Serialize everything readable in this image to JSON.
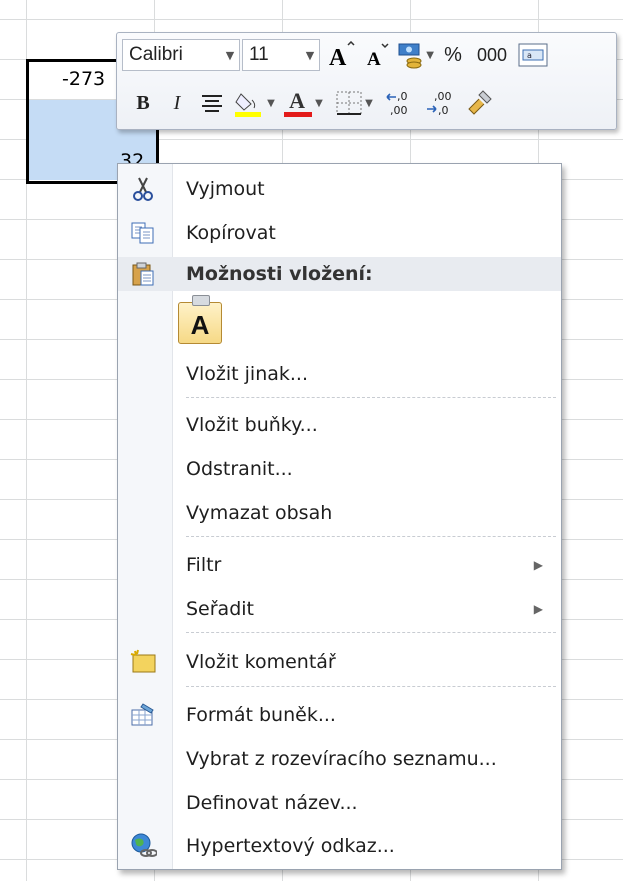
{
  "sheet": {
    "cell_value": "-273",
    "cell_value_2": "32"
  },
  "mini_toolbar": {
    "font_name": "Calibri",
    "font_size": "11",
    "percent": "%",
    "thousands": "000",
    "bold": "B",
    "italic": "I",
    "font_color_letter": "A"
  },
  "context_menu": {
    "cut": "Vyjmout",
    "copy": "Kopírovat",
    "paste_options": "Možnosti vložení:",
    "paste_option_a": "A",
    "paste_special": "Vložit jinak...",
    "insert_cells": "Vložit buňky...",
    "delete": "Odstranit...",
    "clear_contents": "Vymazat obsah",
    "filter": "Filtr",
    "sort": "Seřadit",
    "insert_comment": "Vložit komentář",
    "format_cells": "Formát buněk...",
    "pick_from_list": "Vybrat z rozevíracího seznamu...",
    "define_name": "Definovat název...",
    "hyperlink": "Hypertextový odkaz..."
  },
  "colors": {
    "highlight_yellow": "#ffff00",
    "font_red": "#e31b1b",
    "selection_fill": "#c5dcf5"
  }
}
